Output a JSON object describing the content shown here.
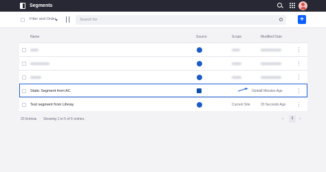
{
  "app": {
    "title": "Segments"
  },
  "toolbar": {
    "filter_label": "Filter and Order",
    "search_placeholder": "Search for",
    "add_label": "+"
  },
  "table": {
    "headers": {
      "name": "Name",
      "source": "Source",
      "scope": "Scope",
      "modified": "Modified Date"
    },
    "rows": [
      {
        "name": "Static Segment from AC",
        "scope": "Global",
        "modified": "2 Minutes Ago",
        "source_icon": "analytics-cloud-icon"
      },
      {
        "name": "Test segment from Liferay",
        "scope": "Current Site",
        "modified": "20 Seconds Ago",
        "source_icon": "liferay-icon"
      }
    ]
  },
  "pagination": {
    "entries": "20 Entries",
    "showing": "Showing 1 to 5 of 5 entries.",
    "page": "1",
    "prev": "‹",
    "next": "›"
  },
  "colors": {
    "accent": "#0b5fff",
    "highlight": "#1b5fd1",
    "topbar": "#272833"
  }
}
